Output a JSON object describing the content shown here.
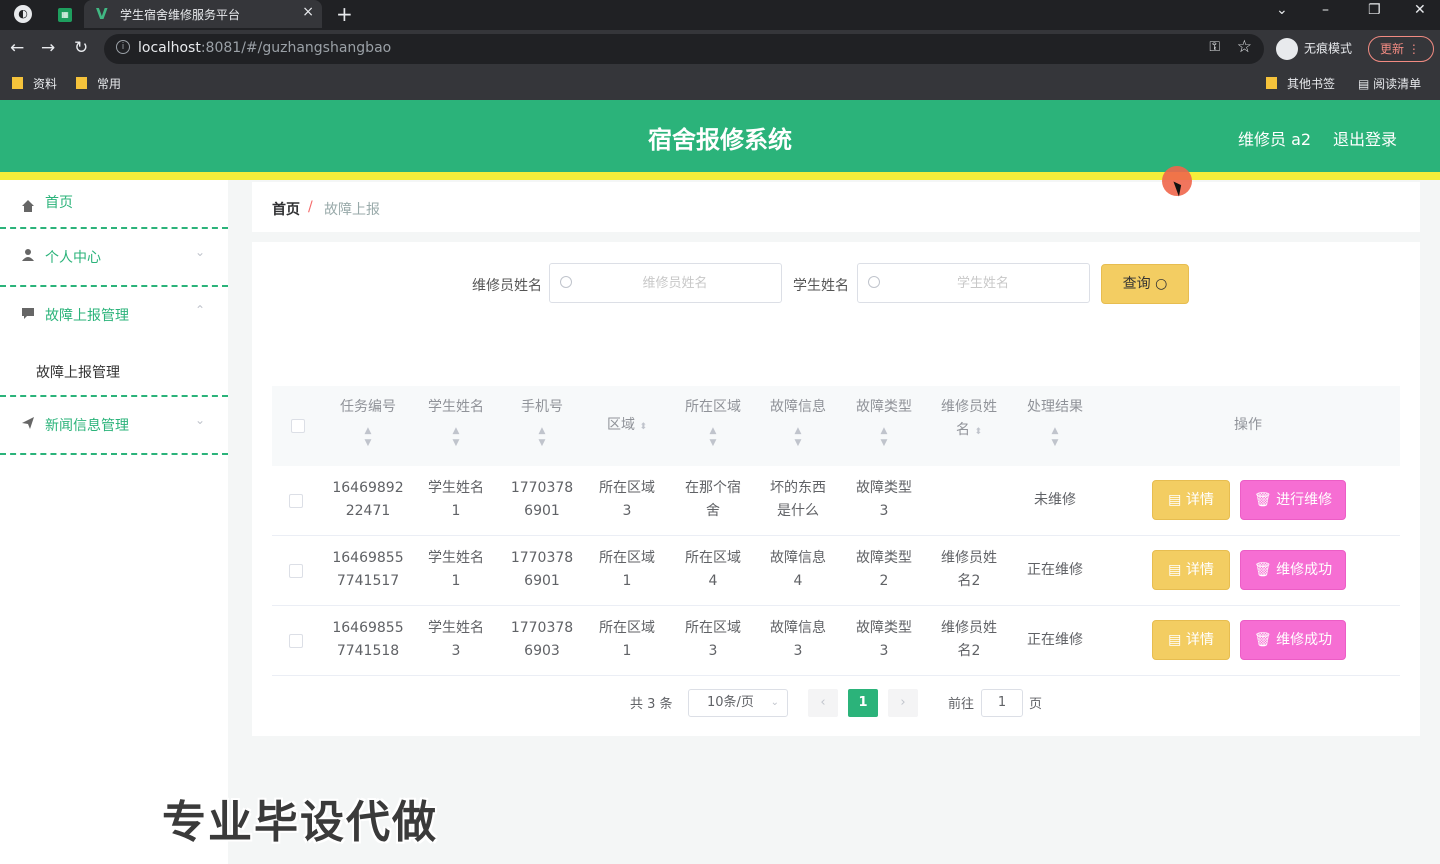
{
  "browser": {
    "tab_title": "学生宿舍维修服务平台",
    "tab_close": "×",
    "new_tab": "+",
    "url_host": "localhost",
    "url_rest": ":8081/#/guzhangshangbao",
    "incognito_label": "无痕模式",
    "update_label": "更新",
    "bookmarks": [
      "资料",
      "常用"
    ],
    "other_bookmarks": "其他书签",
    "reading_list": "阅读清单"
  },
  "header": {
    "title": "宿舍报修系统",
    "user": "维修员 a2",
    "logout": "退出登录"
  },
  "sidebar": {
    "items": [
      {
        "label": "首页"
      },
      {
        "label": "个人中心"
      },
      {
        "label": "故障上报管理"
      },
      {
        "label": "新闻信息管理"
      }
    ],
    "sub_item": "故障上报管理"
  },
  "breadcrumb": {
    "home": "首页",
    "sep": "/",
    "current": "故障上报"
  },
  "search": {
    "repair_label": "维修员姓名",
    "repair_placeholder": "维修员姓名",
    "student_label": "学生姓名",
    "student_placeholder": "学生姓名",
    "query_label": "查询"
  },
  "table": {
    "headers": [
      "任务编号",
      "学生姓名",
      "手机号",
      "区域",
      "所在区域",
      "故障信息",
      "故障类型",
      "维修员姓名",
      "处理结果",
      "操作"
    ],
    "header_wrap": {
      "h7_line1": "维修员姓",
      "h7_line2": "名"
    },
    "rows": [
      {
        "task_l1": "16469892",
        "task_l2": "22471",
        "stu_l1": "学生姓名",
        "stu_l2": "1",
        "phone_l1": "1770378",
        "phone_l2": "6901",
        "area_l1": "所在区域",
        "area_l2": "3",
        "loc_l1": "在那个宿",
        "loc_l2": "舍",
        "info_l1": "坏的东西",
        "info_l2": "是什么",
        "type_l1": "故障类型",
        "type_l2": "3",
        "rep_l1": "",
        "rep_l2": "",
        "result": "未维修",
        "detail": "详情",
        "action": "进行维修"
      },
      {
        "task_l1": "16469855",
        "task_l2": "7741517",
        "stu_l1": "学生姓名",
        "stu_l2": "1",
        "phone_l1": "1770378",
        "phone_l2": "6901",
        "area_l1": "所在区域",
        "area_l2": "1",
        "loc_l1": "所在区域",
        "loc_l2": "4",
        "info_l1": "故障信息",
        "info_l2": "4",
        "type_l1": "故障类型",
        "type_l2": "2",
        "rep_l1": "维修员姓",
        "rep_l2": "名2",
        "result": "正在维修",
        "detail": "详情",
        "action": "维修成功"
      },
      {
        "task_l1": "16469855",
        "task_l2": "7741518",
        "stu_l1": "学生姓名",
        "stu_l2": "3",
        "phone_l1": "1770378",
        "phone_l2": "6903",
        "area_l1": "所在区域",
        "area_l2": "1",
        "loc_l1": "所在区域",
        "loc_l2": "3",
        "info_l1": "故障信息",
        "info_l2": "3",
        "type_l1": "故障类型",
        "type_l2": "3",
        "rep_l1": "维修员姓",
        "rep_l2": "名2",
        "result": "正在维修",
        "detail": "详情",
        "action": "维修成功"
      }
    ]
  },
  "pagination": {
    "total": "共 3 条",
    "page_size": "10条/页",
    "current": "1",
    "goto_label": "前往",
    "goto_value": "1",
    "page_suffix": "页"
  },
  "watermark": "专业毕设代做",
  "colors": {
    "primary": "#2bb37a",
    "accent_yellow": "#f5ee3a",
    "button_yellow": "#f3cd62",
    "button_pink": "#f66ed3"
  }
}
